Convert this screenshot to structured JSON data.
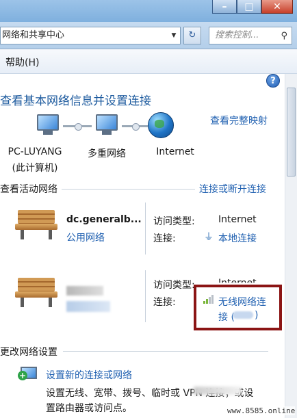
{
  "address_bar": {
    "path": "网络和共享中心",
    "search_placeholder": "搜索控制..."
  },
  "menu": {
    "help": "帮助(H)"
  },
  "header": {
    "title": "查看基本网络信息并设置连接",
    "full_map_link": "查看完整映射"
  },
  "network_map": {
    "computer_name": "PC-LUYANG",
    "computer_sub": "(此计算机)",
    "multi_network": "多重网络",
    "internet": "Internet"
  },
  "active_networks": {
    "section_title": "查看活动网络",
    "connect_link": "连接或断开连接",
    "networks": [
      {
        "name": "dc.generalb...",
        "type": "公用网络",
        "access_label": "访问类型:",
        "access_value": "Internet",
        "conn_label": "连接:",
        "conn_value": "本地连接"
      },
      {
        "access_label": "访问类型:",
        "access_value": "Internet",
        "conn_label": "连接:",
        "conn_value_line1": "无线网络连",
        "conn_value_line2": "接 (",
        "conn_value_line2_end": ")"
      }
    ]
  },
  "change_settings": {
    "section_title": "更改网络设置",
    "setup_link": "设置新的连接或网络",
    "setup_desc_line1": "设置无线、宽带、拨号、临时或 VPN 连接；或设",
    "setup_desc_line2": "置路由器或访问点。"
  },
  "watermark": "www.8585.online",
  "icons": [
    "minimize-icon",
    "maximize-icon",
    "close-icon",
    "refresh-icon",
    "search-icon",
    "help-icon",
    "computer-icon",
    "multi-network-icon",
    "globe-icon",
    "bench-icon",
    "plug-icon",
    "signal-icon",
    "setup-connection-icon"
  ]
}
